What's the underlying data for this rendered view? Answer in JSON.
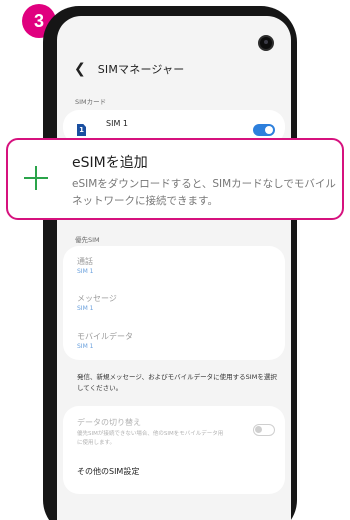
{
  "step": {
    "number": "3"
  },
  "header": {
    "title": "SIMマネージャー",
    "back_icon": "arrow-back-icon"
  },
  "sim_card_section": {
    "label": "SIMカード",
    "sim1": {
      "badge": "1",
      "label": "SIM 1",
      "enabled": true
    }
  },
  "popup": {
    "icon": "plus-icon",
    "title": "eSIMを追加",
    "description": "eSIMをダウンロードすると、SIMカードなしでモバイルネットワークに接続できます。"
  },
  "preferred_sim_section": {
    "label": "優先SIM",
    "rows": [
      {
        "title": "通話",
        "value": "SIM 1"
      },
      {
        "title": "メッセージ",
        "value": "SIM 1"
      },
      {
        "title": "モバイルデータ",
        "value": "SIM 1"
      }
    ]
  },
  "info": {
    "text": "発信、新規メッセージ、およびモバイルデータに使用するSIMを選択してください。"
  },
  "data_switch": {
    "title": "データの切り替え",
    "description": "優先SIMが接続できない場合、他のSIMをモバイルデータ用に使用します。",
    "enabled": false
  },
  "other_settings": {
    "label": "その他のSIM設定"
  },
  "colors": {
    "accent": "#d6117e",
    "badge": "#e0007f",
    "toggle_on": "#2d7fdc",
    "plus": "#2aa44a",
    "sim_value": "#6aa0dd"
  }
}
